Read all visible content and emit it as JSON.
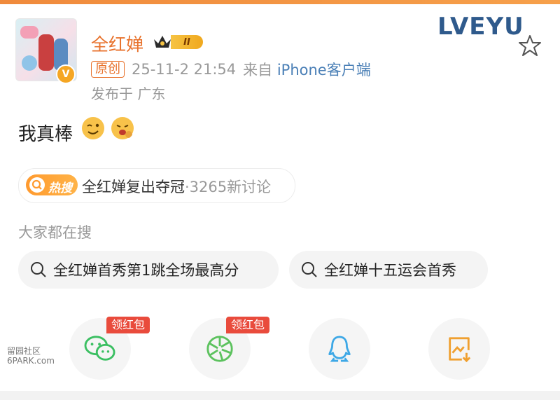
{
  "post": {
    "username": "全红婵",
    "rank_badge": "II",
    "original_tag": "原创",
    "timestamp": "25-11-2 21:54",
    "from_label": "来自",
    "source": "iPhone客户端",
    "location": "发布于 广东",
    "text": "我真棒"
  },
  "decor": {
    "love_sticker": "LVEYU"
  },
  "hot_search": {
    "badge": "热搜",
    "topic": "全红婵复出夺冠",
    "count": "·3265新讨论"
  },
  "suggestions": {
    "heading": "大家都在搜",
    "items": [
      "全红婵首秀第1跳全场最高分",
      "全红婵十五运会首秀"
    ]
  },
  "share": {
    "red_packet_label": "领红包",
    "items": [
      "wechat-icon",
      "moments-icon",
      "qq-icon",
      "save-image-icon"
    ]
  },
  "watermark": {
    "line1": "留园社区",
    "line2": "6PARK.com"
  },
  "colors": {
    "accent": "#e8722c",
    "link": "#4a7fb6",
    "hot": "#ff9a2e",
    "red_tag": "#e94b3c"
  }
}
